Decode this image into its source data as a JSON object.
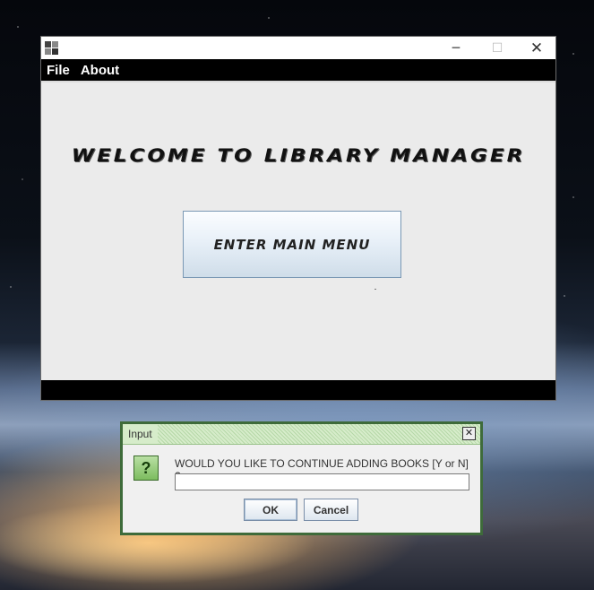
{
  "window": {
    "controls": {
      "minimize": "─",
      "maximize": "☐",
      "close": "✕"
    },
    "menu": [
      "File",
      "About"
    ],
    "welcome_text": "WELCOME TO LIBRARY MANAGER",
    "enter_button": "ENTER MAIN MENU"
  },
  "dialog": {
    "title": "Input",
    "close_glyph": "✕",
    "icon_glyph": "?",
    "prompt": "WOULD YOU LIKE TO CONTINUE ADDING BOOKS [Y or N] ?:",
    "input_value": "",
    "ok_label": "OK",
    "cancel_label": "Cancel"
  },
  "colors": {
    "dialog_border": "#3e6b3a",
    "menubar": "#000000",
    "icon_green": "#7cbc5e"
  }
}
